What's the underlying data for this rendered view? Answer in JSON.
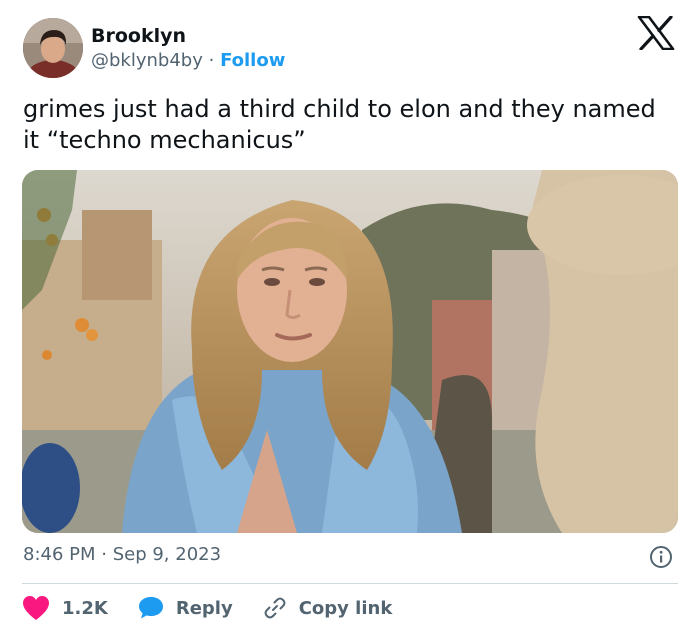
{
  "author": {
    "name": "Brooklyn",
    "handle": "@bklynb4by",
    "separator": "·",
    "follow_label": "Follow"
  },
  "tweet": {
    "text": "grimes just had a third child to elon and they named it “techno mechanicus”",
    "timestamp": "8:46 PM · Sep 9, 2023"
  },
  "actions": {
    "likes": "1.2K",
    "reply_label": "Reply",
    "copy_link_label": "Copy link"
  },
  "icons": {
    "brand": "x-logo-icon",
    "info": "info-icon",
    "like": "heart-icon",
    "reply": "chat-bubble-icon",
    "copy": "link-icon"
  },
  "colors": {
    "accent": "#1d9bf0",
    "like": "#f91880",
    "text": "#0f1419",
    "muted": "#536471",
    "divider": "#cfd9de"
  }
}
